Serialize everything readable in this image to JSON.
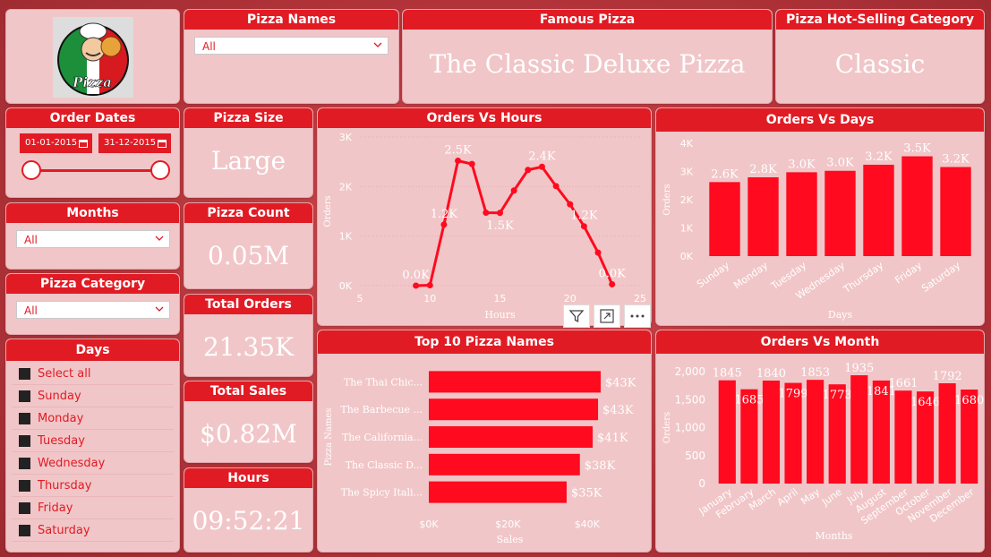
{
  "logo": {
    "text": "Pizza"
  },
  "pizza_names": {
    "title": "Pizza Names",
    "selected": "All"
  },
  "famous_pizza": {
    "title": "Famous Pizza",
    "value": "The Classic Deluxe Pizza"
  },
  "hot_category": {
    "title": "Pizza Hot-Selling Category",
    "value": "Classic"
  },
  "order_dates": {
    "title": "Order Dates",
    "start": "01-01-2015",
    "end": "31-12-2015"
  },
  "months": {
    "title": "Months",
    "selected": "All"
  },
  "pizza_category": {
    "title": "Pizza Category",
    "selected": "All"
  },
  "days_slicer": {
    "title": "Days",
    "items": [
      "Select all",
      "Sunday",
      "Monday",
      "Tuesday",
      "Wednesday",
      "Thursday",
      "Friday",
      "Saturday"
    ]
  },
  "kpis": {
    "pizza_size": {
      "title": "Pizza Size",
      "value": "Large"
    },
    "pizza_count": {
      "title": "Pizza Count",
      "value": "0.05M"
    },
    "total_orders": {
      "title": "Total Orders",
      "value": "21.35K"
    },
    "total_sales": {
      "title": "Total Sales",
      "value": "$0.82M"
    },
    "hours": {
      "title": "Hours",
      "value": "09:52:21"
    }
  },
  "chart_data": [
    {
      "id": "orders-vs-hours",
      "type": "line",
      "title": "Orders Vs Hours",
      "xlabel": "Hours",
      "ylabel": "Orders",
      "x": [
        9,
        10,
        11,
        12,
        13,
        14,
        15,
        16,
        17,
        18,
        19,
        20,
        21,
        22,
        23
      ],
      "values": [
        1,
        8,
        1231,
        2520,
        2455,
        1472,
        1468,
        1920,
        2336,
        2399,
        2009,
        1642,
        1198,
        667,
        28
      ],
      "data_labels": {
        "9": "0.0K",
        "11": "1.2K",
        "12": "2.5K",
        "15": "1.5K",
        "18": "2.4K",
        "21": "1.2K",
        "23": "0.0K"
      },
      "xlim": [
        5,
        25
      ],
      "ylim": [
        0,
        3000
      ],
      "xticks": [
        "5",
        "10",
        "15",
        "20",
        "25"
      ],
      "yticks": [
        "0K",
        "1K",
        "2K",
        "3K"
      ],
      "color": "#ff0a1f"
    },
    {
      "id": "orders-vs-days",
      "type": "bar",
      "title": "Orders Vs Days",
      "xlabel": "Days",
      "ylabel": "Orders",
      "categories": [
        "Sunday",
        "Monday",
        "Tuesday",
        "Wednesday",
        "Thursday",
        "Friday",
        "Saturday"
      ],
      "values": [
        2624,
        2794,
        2973,
        3024,
        3239,
        3538,
        3158
      ],
      "data_labels": [
        "2.6K",
        "2.8K",
        "3.0K",
        "3.0K",
        "3.2K",
        "3.5K",
        "3.2K"
      ],
      "ylim": [
        0,
        4000
      ],
      "yticks": [
        "0K",
        "1K",
        "2K",
        "3K",
        "4K"
      ],
      "color": "#ff0a1f"
    },
    {
      "id": "top-10-pizza-names",
      "type": "bar",
      "orientation": "horizontal",
      "title": "Top 10 Pizza Names",
      "xlabel": "Sales",
      "ylabel": "Pizza Names",
      "categories": [
        "The Thai Chic...",
        "The Barbecue ...",
        "The California...",
        "The Classic D...",
        "The Spicy Itali..."
      ],
      "values": [
        43434,
        42768,
        41410,
        38180,
        34831
      ],
      "data_labels": [
        "$43K",
        "$43K",
        "$41K",
        "$38K",
        "$35K"
      ],
      "xlim": [
        0,
        50000
      ],
      "xticks": [
        "$0K",
        "$20K",
        "$40K"
      ],
      "color": "#ff0a1f"
    },
    {
      "id": "orders-vs-month",
      "type": "bar",
      "title": "Orders Vs Month",
      "xlabel": "Months",
      "ylabel": "Orders",
      "categories": [
        "January",
        "February",
        "March",
        "April",
        "May",
        "June",
        "July",
        "August",
        "September",
        "October",
        "November",
        "December"
      ],
      "values": [
        1845,
        1685,
        1840,
        1799,
        1853,
        1773,
        1935,
        1841,
        1661,
        1646,
        1792,
        1680
      ],
      "data_labels": [
        "1845",
        "1685",
        "1840",
        "1799",
        "1853",
        "1773",
        "1935",
        "1841",
        "1661",
        "1646",
        "1792",
        "1680"
      ],
      "ylim": [
        0,
        2000
      ],
      "yticks": [
        "0",
        "500",
        "1,000",
        "1,500",
        "2,000"
      ],
      "color": "#ff0a1f"
    }
  ],
  "visual_toolbar": {
    "icons": [
      "filter-icon",
      "focus-mode-icon",
      "more-options-icon"
    ]
  }
}
